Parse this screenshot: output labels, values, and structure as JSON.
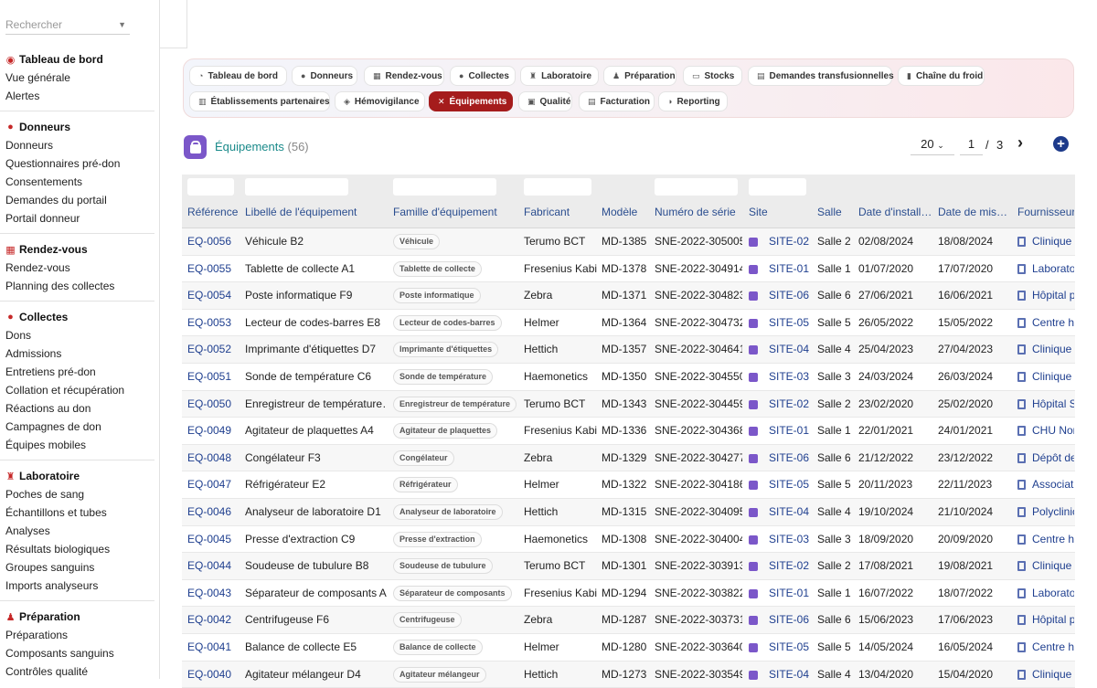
{
  "sidebar": {
    "search_placeholder": "Rechercher",
    "sections": [
      {
        "title": "Tableau de bord",
        "icon": "dashboard-icon",
        "items": [
          "Vue générale",
          "Alertes"
        ]
      },
      {
        "title": "Donneurs",
        "icon": "person-icon",
        "items": [
          "Donneurs",
          "Questionnaires pré-don",
          "Consentements",
          "Demandes du portail",
          "Portail donneur"
        ]
      },
      {
        "title": "Rendez-vous",
        "icon": "calendar-icon",
        "items": [
          "Rendez-vous",
          "Planning des collectes"
        ]
      },
      {
        "title": "Collectes",
        "icon": "drop-icon",
        "items": [
          "Dons",
          "Admissions",
          "Entretiens pré-don",
          "Collation et récupération",
          "Réactions au don",
          "Campagnes de don",
          "Équipes mobiles"
        ]
      },
      {
        "title": "Laboratoire",
        "icon": "microscope-icon",
        "items": [
          "Poches de sang",
          "Échantillons et tubes",
          "Analyses",
          "Résultats biologiques",
          "Groupes sanguins",
          "Imports analyseurs"
        ]
      },
      {
        "title": "Préparation",
        "icon": "flask-icon",
        "items": [
          "Préparations",
          "Composants sanguins",
          "Contrôles qualité"
        ]
      }
    ]
  },
  "tabs": [
    {
      "label": "Tableau de bord",
      "icon": "dashboard-icon",
      "active": false
    },
    {
      "label": "Donneurs",
      "icon": "person-icon",
      "active": false
    },
    {
      "label": "Rendez-vous",
      "icon": "calendar-icon",
      "active": false
    },
    {
      "label": "Collectes",
      "icon": "drop-icon",
      "active": false
    },
    {
      "label": "Laboratoire",
      "icon": "microscope-icon",
      "active": false
    },
    {
      "label": "Préparation",
      "icon": "flask-icon",
      "active": false
    },
    {
      "label": "Stocks",
      "icon": "warehouse-icon",
      "active": false
    },
    {
      "label": "Demandes transfusionnelles",
      "icon": "document-icon",
      "active": false
    },
    {
      "label": "Chaîne du froid",
      "icon": "thermometer-icon",
      "active": false
    },
    {
      "label": "Établissements partenaires",
      "icon": "building-icon",
      "active": false
    },
    {
      "label": "Hémovigilance",
      "icon": "shield-icon",
      "active": false
    },
    {
      "label": "Équipements",
      "icon": "tools-icon",
      "active": true
    },
    {
      "label": "Qualité",
      "icon": "clipboard-icon",
      "active": false
    },
    {
      "label": "Facturation",
      "icon": "invoice-icon",
      "active": false
    },
    {
      "label": "Reporting",
      "icon": "chart-icon",
      "active": false
    }
  ],
  "page": {
    "title": "Équipements",
    "count": "(56)",
    "per_page": "20",
    "current_page": "1",
    "page_separator": "/",
    "total_pages": "3",
    "accent": "#a51c1c"
  },
  "table": {
    "columns": [
      "Référence",
      "Libellé de l'équipement",
      "Famille d'équipement",
      "Fabricant",
      "Modèle",
      "Numéro de série",
      "Site",
      "Salle",
      "Date d'install…",
      "Date de mis…",
      "Fournisseur"
    ],
    "rows": [
      [
        "EQ-0056",
        "Véhicule B2",
        "Véhicule",
        "Terumo BCT",
        "MD-1385",
        "SNE-2022-305005",
        "SITE-02",
        "Salle 2",
        "02/08/2024",
        "18/08/2024",
        "Clinique r"
      ],
      [
        "EQ-0055",
        "Tablette de collecte A1",
        "Tablette de collecte",
        "Fresenius Kabi",
        "MD-1378",
        "SNE-2022-304914",
        "SITE-01",
        "Salle 1",
        "01/07/2020",
        "17/07/2020",
        "Laborato"
      ],
      [
        "EQ-0054",
        "Poste informatique F9",
        "Poste informatique",
        "Zebra",
        "MD-1371",
        "SNE-2022-304823",
        "SITE-06",
        "Salle 6",
        "27/06/2021",
        "16/06/2021",
        "Hôpital pr"
      ],
      [
        "EQ-0053",
        "Lecteur de codes-barres E8",
        "Lecteur de codes-barres",
        "Helmer",
        "MD-1364",
        "SNE-2022-304732",
        "SITE-05",
        "Salle 5",
        "26/05/2022",
        "15/05/2022",
        "Centre ho"
      ],
      [
        "EQ-0052",
        "Imprimante d'étiquettes D7",
        "Imprimante d'étiquettes",
        "Hettich",
        "MD-1357",
        "SNE-2022-304641",
        "SITE-04",
        "Salle 4",
        "25/04/2023",
        "27/04/2023",
        "Clinique d"
      ],
      [
        "EQ-0051",
        "Sonde de température C6",
        "Sonde de température",
        "Haemonetics",
        "MD-1350",
        "SNE-2022-304550",
        "SITE-03",
        "Salle 3",
        "24/03/2024",
        "26/03/2024",
        "Clinique d"
      ],
      [
        "EQ-0050",
        "Enregistreur de température…",
        "Enregistreur de température",
        "Terumo BCT",
        "MD-1343",
        "SNE-2022-304459",
        "SITE-02",
        "Salle 2",
        "23/02/2020",
        "25/02/2020",
        "Hôpital S"
      ],
      [
        "EQ-0049",
        "Agitateur de plaquettes A4",
        "Agitateur de plaquettes",
        "Fresenius Kabi",
        "MD-1336",
        "SNE-2022-304368",
        "SITE-01",
        "Salle 1",
        "22/01/2021",
        "24/01/2021",
        "CHU Nor"
      ],
      [
        "EQ-0048",
        "Congélateur F3",
        "Congélateur",
        "Zebra",
        "MD-1329",
        "SNE-2022-304277",
        "SITE-06",
        "Salle 6",
        "21/12/2022",
        "23/12/2022",
        "Dépôt de"
      ],
      [
        "EQ-0047",
        "Réfrigérateur E2",
        "Réfrigérateur",
        "Helmer",
        "MD-1322",
        "SNE-2022-304186",
        "SITE-05",
        "Salle 5",
        "20/11/2023",
        "22/11/2023",
        "Associati"
      ],
      [
        "EQ-0046",
        "Analyseur de laboratoire D1",
        "Analyseur de laboratoire",
        "Hettich",
        "MD-1315",
        "SNE-2022-304095",
        "SITE-04",
        "Salle 4",
        "19/10/2024",
        "21/10/2024",
        "Polyclinic"
      ],
      [
        "EQ-0045",
        "Presse d'extraction C9",
        "Presse d'extraction",
        "Haemonetics",
        "MD-1308",
        "SNE-2022-304004",
        "SITE-03",
        "Salle 3",
        "18/09/2020",
        "20/09/2020",
        "Centre ho"
      ],
      [
        "EQ-0044",
        "Soudeuse de tubulure B8",
        "Soudeuse de tubulure",
        "Terumo BCT",
        "MD-1301",
        "SNE-2022-303913",
        "SITE-02",
        "Salle 2",
        "17/08/2021",
        "19/08/2021",
        "Clinique r"
      ],
      [
        "EQ-0043",
        "Séparateur de composants A7",
        "Séparateur de composants",
        "Fresenius Kabi",
        "MD-1294",
        "SNE-2022-303822",
        "SITE-01",
        "Salle 1",
        "16/07/2022",
        "18/07/2022",
        "Laborato"
      ],
      [
        "EQ-0042",
        "Centrifugeuse F6",
        "Centrifugeuse",
        "Zebra",
        "MD-1287",
        "SNE-2022-303731",
        "SITE-06",
        "Salle 6",
        "15/06/2023",
        "17/06/2023",
        "Hôpital pr"
      ],
      [
        "EQ-0041",
        "Balance de collecte E5",
        "Balance de collecte",
        "Helmer",
        "MD-1280",
        "SNE-2022-303640",
        "SITE-05",
        "Salle 5",
        "14/05/2024",
        "16/05/2024",
        "Centre ho"
      ],
      [
        "EQ-0040",
        "Agitateur mélangeur D4",
        "Agitateur mélangeur",
        "Hettich",
        "MD-1273",
        "SNE-2022-303549",
        "SITE-04",
        "Salle 4",
        "13/04/2020",
        "15/04/2020",
        "Clinique d"
      ]
    ]
  }
}
